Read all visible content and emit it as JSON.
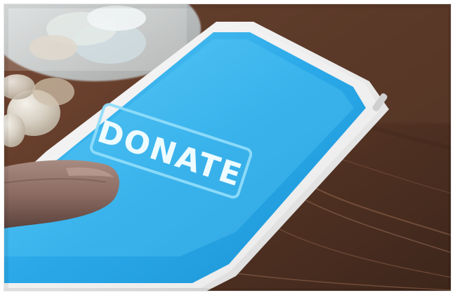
{
  "scene": {
    "button_label": "DONATE",
    "colors": {
      "screen_blue": "#2aa8e8",
      "screen_blue_light": "#4cc0f2",
      "wood_dark": "#4d2f1f",
      "wood_mid": "#6b4330",
      "wood_light": "#8a5a40",
      "phone_white": "#efefef",
      "coin_silver": "#d7d1c6",
      "finger_tone": "#8a6c63"
    }
  }
}
